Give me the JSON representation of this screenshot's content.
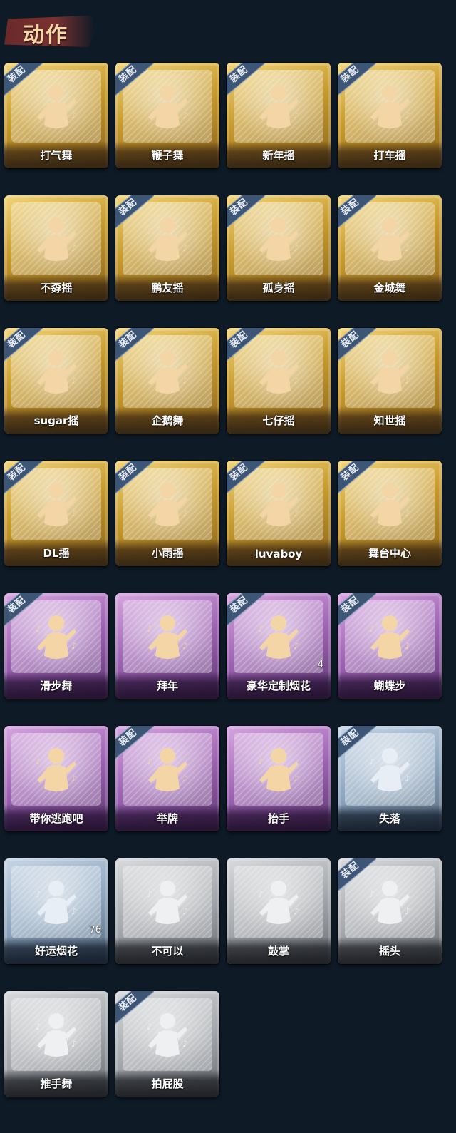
{
  "header": {
    "title": "动作"
  },
  "equip_label": "装配",
  "items": [
    {
      "label": "打气舞",
      "tier": "gold",
      "equipped": true
    },
    {
      "label": "鞭子舞",
      "tier": "gold",
      "equipped": true
    },
    {
      "label": "新年摇",
      "tier": "gold",
      "equipped": true
    },
    {
      "label": "打车摇",
      "tier": "gold",
      "equipped": true
    },
    {
      "label": "不孬摇",
      "tier": "gold",
      "equipped": false
    },
    {
      "label": "鹏友摇",
      "tier": "gold",
      "equipped": true
    },
    {
      "label": "孤身摇",
      "tier": "gold",
      "equipped": true
    },
    {
      "label": "金城舞",
      "tier": "gold",
      "equipped": true
    },
    {
      "label": "sugar摇",
      "tier": "gold",
      "equipped": true
    },
    {
      "label": "企鹅舞",
      "tier": "gold",
      "equipped": true
    },
    {
      "label": "七仔摇",
      "tier": "gold",
      "equipped": true
    },
    {
      "label": "知世摇",
      "tier": "gold",
      "equipped": true
    },
    {
      "label": "DL摇",
      "tier": "gold",
      "equipped": true
    },
    {
      "label": "小雨摇",
      "tier": "gold",
      "equipped": true
    },
    {
      "label": "luvaboy",
      "tier": "gold",
      "equipped": true
    },
    {
      "label": "舞台中心",
      "tier": "gold",
      "equipped": true
    },
    {
      "label": "滑步舞",
      "tier": "purple",
      "equipped": true
    },
    {
      "label": "拜年",
      "tier": "purple",
      "equipped": false
    },
    {
      "label": "豪华定制烟花",
      "tier": "purple",
      "equipped": true,
      "count": "4"
    },
    {
      "label": "蝴蝶步",
      "tier": "purple",
      "equipped": true
    },
    {
      "label": "带你逃跑吧",
      "tier": "purple",
      "equipped": false
    },
    {
      "label": "举牌",
      "tier": "purple",
      "equipped": true
    },
    {
      "label": "抬手",
      "tier": "purple",
      "equipped": false
    },
    {
      "label": "失落",
      "tier": "blue",
      "equipped": true
    },
    {
      "label": "好运烟花",
      "tier": "blue",
      "equipped": false,
      "count": "76"
    },
    {
      "label": "不可以",
      "tier": "gray",
      "equipped": false
    },
    {
      "label": "鼓掌",
      "tier": "gray",
      "equipped": false
    },
    {
      "label": "摇头",
      "tier": "gray",
      "equipped": true
    },
    {
      "label": "推手舞",
      "tier": "gray",
      "equipped": false
    },
    {
      "label": "拍屁股",
      "tier": "gray",
      "equipped": true
    }
  ]
}
